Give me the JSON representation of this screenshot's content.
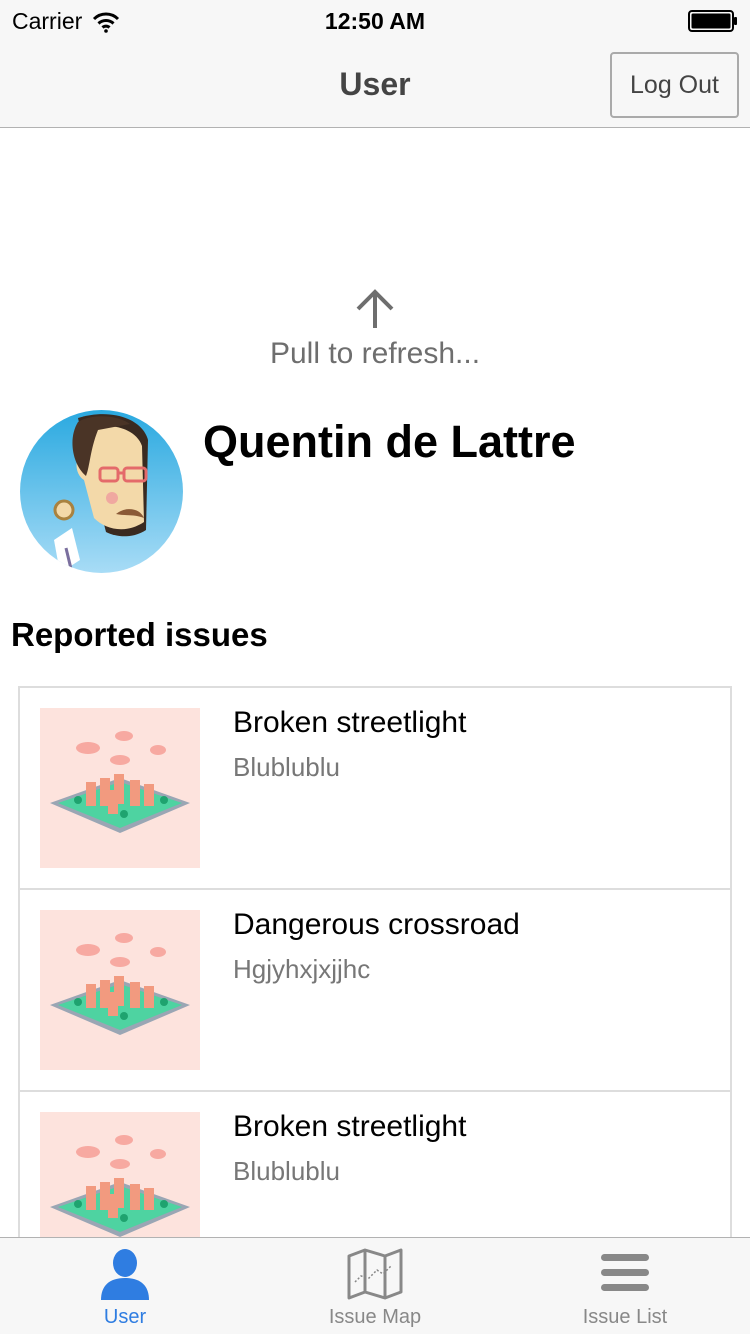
{
  "status_bar": {
    "carrier": "Carrier",
    "time": "12:50 AM"
  },
  "nav": {
    "title": "User",
    "logout_label": "Log Out"
  },
  "refresh": {
    "text": "Pull to refresh..."
  },
  "profile": {
    "name": "Quentin de Lattre"
  },
  "issues": {
    "section_title": "Reported issues",
    "items": [
      {
        "title": "Broken streetlight",
        "subtitle": "Blublublu"
      },
      {
        "title": "Dangerous crossroad",
        "subtitle": "Hgjyhxjxjjhc"
      },
      {
        "title": "Broken streetlight",
        "subtitle": "Blublublu"
      }
    ]
  },
  "tabs": [
    {
      "label": "User",
      "icon": "person-icon",
      "active": true
    },
    {
      "label": "Issue Map",
      "icon": "map-icon",
      "active": false
    },
    {
      "label": "Issue List",
      "icon": "list-icon",
      "active": false
    }
  ],
  "colors": {
    "accent": "#2f7de1",
    "thumb_background": "#fde3dd"
  }
}
